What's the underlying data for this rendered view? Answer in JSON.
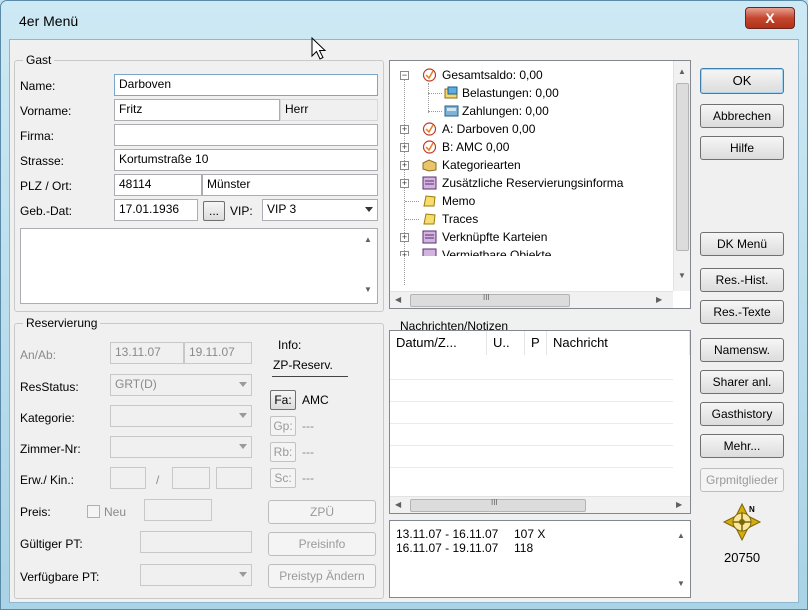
{
  "window": {
    "title": "4er Menü",
    "close_glyph": "X"
  },
  "guest": {
    "group_title": "Gast",
    "name_label": "Name:",
    "name_value": "Darboven",
    "firstname_label": "Vorname:",
    "firstname_value": "Fritz",
    "salutation_value": "Herr",
    "company_label": "Firma:",
    "company_value": "",
    "street_label": "Strasse:",
    "street_value": "Kortumstraße 10",
    "zip_city_label": "PLZ / Ort:",
    "zip_value": "48114",
    "city_value": "Münster",
    "birth_label": "Geb.-Dat:",
    "birth_value": "17.01.1936",
    "birth_btn": "...",
    "vip_label": "VIP:",
    "vip_value": "VIP 3"
  },
  "reservation": {
    "group_title": "Reservierung",
    "arrdep_label": "An/Ab:",
    "arrival": "13.11.07",
    "departure": "19.11.07",
    "status_label": "ResStatus:",
    "status_value": "GRT(D)",
    "category_label": "Kategorie:",
    "category_value": "",
    "room_label": "Zimmer-Nr:",
    "room_value": "",
    "adults_label": "Erw./ Kin.:",
    "sep": "/",
    "price_label": "Preis:",
    "new_label": "Neu",
    "valid_pt_label": "Gültiger PT:",
    "avail_pt_label": "Verfügbare PT:"
  },
  "info": {
    "info_label": "Info:",
    "zp_label": "ZP-Reserv.",
    "fa_btn": "Fa:",
    "fa_value": "AMC",
    "gp_btn": "Gp:",
    "gp_value": "---",
    "rb_btn": "Rb:",
    "rb_value": "---",
    "sc_btn": "Sc:",
    "sc_value": "---",
    "zpu_btn": "ZPÜ",
    "preisinfo_btn": "Preisinfo",
    "preistyp_btn": "Preistyp Ändern"
  },
  "tree": {
    "items": [
      {
        "label": "Gesamtsaldo: 0,00",
        "icon": "account-icon"
      },
      {
        "label": "Belastungen: 0,00",
        "icon": "charges-icon"
      },
      {
        "label": "Zahlungen: 0,00",
        "icon": "payments-icon"
      },
      {
        "label": "A: Darboven 0,00",
        "icon": "account-icon"
      },
      {
        "label": "B: AMC  0,00",
        "icon": "account-icon"
      },
      {
        "label": "Kategoriearten",
        "icon": "box-icon"
      },
      {
        "label": "Zusätzliche Reservierungsinforma",
        "icon": "book-icon"
      },
      {
        "label": "Memo",
        "icon": "note-icon"
      },
      {
        "label": "Traces",
        "icon": "note-icon"
      },
      {
        "label": "Verknüpfte Karteien",
        "icon": "book-icon"
      },
      {
        "label": "Vermietbare Objekte",
        "icon": "book-icon"
      }
    ]
  },
  "messages": {
    "group_title": "Nachrichten/Notizen",
    "columns": [
      "Datum/Z...",
      "U..",
      "P",
      "Nachricht"
    ]
  },
  "notes": {
    "lines": [
      {
        "range": "13.11.07 - 16.11.07",
        "text": "107 X"
      },
      {
        "range": "16.11.07 - 19.11.07",
        "text": "118"
      }
    ]
  },
  "buttons": {
    "ok": "OK",
    "cancel": "Abbrechen",
    "help": "Hilfe",
    "dk_menu": "DK Menü",
    "res_hist": "Res.-Hist.",
    "res_texte": "Res.-Texte",
    "namensw": "Namensw.",
    "sharer": "Sharer anl.",
    "gasthistory": "Gasthistory",
    "mehr": "Mehr...",
    "grpmitglieder": "Grpmitglieder"
  },
  "compass_number": "20750",
  "scroll_glyph": "III"
}
